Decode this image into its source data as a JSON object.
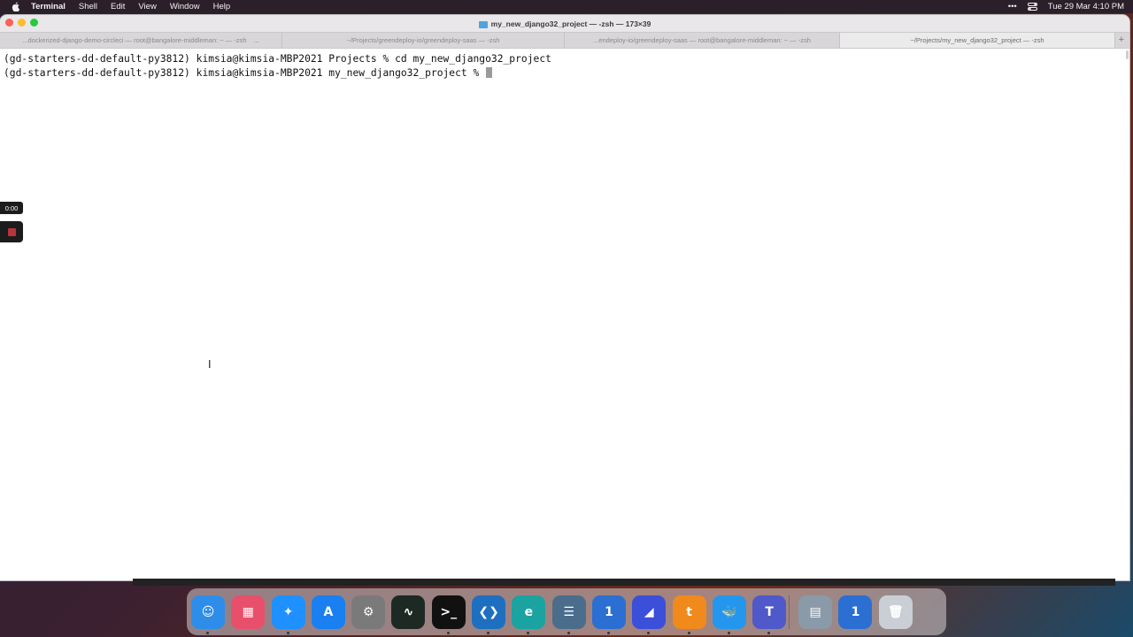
{
  "menubar": {
    "app_name": "Terminal",
    "items": [
      "Shell",
      "Edit",
      "View",
      "Window",
      "Help"
    ],
    "clock": "Tue 29 Mar  4:10 PM",
    "more": "•••"
  },
  "window": {
    "title": "my_new_django32_project — -zsh — 173×39",
    "tabs": [
      {
        "label": "...dockerized-django-demo-circleci — root@bangalore-middleman: ~ — -zsh",
        "extra": "...",
        "active": false
      },
      {
        "label": "~/Projects/greendeploy-io/greendeploy-saas — -zsh",
        "active": false
      },
      {
        "label": "...endeploy-io/greendeploy-saas — root@bangalore-middleman: ~ — -zsh",
        "active": false
      },
      {
        "label": "~/Projects/my_new_django32_project — -zsh",
        "active": true
      }
    ],
    "new_tab": "+"
  },
  "terminal": {
    "lines": [
      "(gd-starters-dd-default-py3812) kimsia@kimsia-MBP2021 Projects % cd my_new_django32_project",
      "(gd-starters-dd-default-py3812) kimsia@kimsia-MBP2021 my_new_django32_project % "
    ]
  },
  "recorder": {
    "time": "0:00"
  },
  "dock": {
    "apps": [
      {
        "name": "finder-icon",
        "glyph": "☺",
        "color": "#2e8de8",
        "running": true
      },
      {
        "name": "launchpad-icon",
        "glyph": "▦",
        "color": "#e84f6b",
        "running": false
      },
      {
        "name": "safari-icon",
        "glyph": "✦",
        "color": "#1e90ff",
        "running": true
      },
      {
        "name": "app-store-icon",
        "glyph": "A",
        "color": "#1a7ff0",
        "running": false
      },
      {
        "name": "system-preferences-icon",
        "glyph": "⚙",
        "color": "#7a7a7a",
        "running": false
      },
      {
        "name": "activity-monitor-icon",
        "glyph": "∿",
        "color": "#1d2a24",
        "running": false
      },
      {
        "name": "terminal-icon",
        "glyph": ">_",
        "color": "#111111",
        "running": true
      },
      {
        "name": "vscode-icon",
        "glyph": "❮❯",
        "color": "#1f6fc0",
        "running": true
      },
      {
        "name": "edge-icon",
        "glyph": "e",
        "color": "#1aa3a0",
        "running": true
      },
      {
        "name": "archive-icon",
        "glyph": "☰",
        "color": "#4a6d8c",
        "running": true
      },
      {
        "name": "1password-icon",
        "glyph": "1",
        "color": "#2a6fd1",
        "running": true
      },
      {
        "name": "linear-icon",
        "glyph": "◢",
        "color": "#3b4fd8",
        "running": true
      },
      {
        "name": "transmit-icon",
        "glyph": "t",
        "color": "#f08a1c",
        "running": true
      },
      {
        "name": "docker-icon",
        "glyph": "🐳",
        "color": "#2496ed",
        "running": true
      },
      {
        "name": "teams-icon",
        "glyph": "T",
        "color": "#5059c9",
        "running": true
      }
    ],
    "others": [
      {
        "name": "preview-icon",
        "glyph": "▤",
        "color": "#8a9aa8"
      },
      {
        "name": "1password-doc-icon",
        "glyph": "1",
        "color": "#2a6fd1"
      },
      {
        "name": "trash-icon",
        "glyph": "🗑",
        "color": "#c9cfd4"
      }
    ]
  }
}
